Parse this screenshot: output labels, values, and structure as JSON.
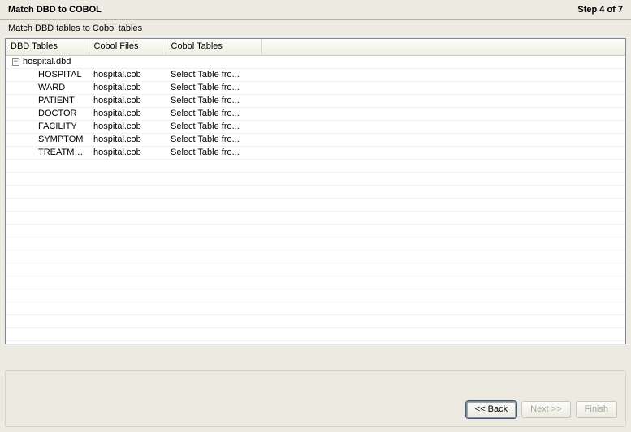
{
  "title": "Match DBD to COBOL",
  "step_label": "Step 4 of 7",
  "subtitle": "Match DBD tables to Cobol tables",
  "columns": {
    "dbd": "DBD Tables",
    "file": "Cobol Files",
    "cobol": "Cobol Tables"
  },
  "tree": {
    "parent": "hospital.dbd",
    "expanded": true,
    "children": [
      {
        "dbd": "HOSPITAL",
        "file": "hospital.cob",
        "cobol": "Select Table fro..."
      },
      {
        "dbd": "WARD",
        "file": "hospital.cob",
        "cobol": "Select Table fro..."
      },
      {
        "dbd": "PATIENT",
        "file": "hospital.cob",
        "cobol": "Select Table fro..."
      },
      {
        "dbd": "DOCTOR",
        "file": "hospital.cob",
        "cobol": "Select Table fro..."
      },
      {
        "dbd": "FACILITY",
        "file": "hospital.cob",
        "cobol": "Select Table fro..."
      },
      {
        "dbd": "SYMPTOM",
        "file": "hospital.cob",
        "cobol": "Select Table fro..."
      },
      {
        "dbd": "TREATMNT",
        "file": "hospital.cob",
        "cobol": "Select Table fro..."
      }
    ]
  },
  "buttons": {
    "back": "<< Back",
    "next": "Next >>",
    "finish": "Finish"
  },
  "empty_row_count": 14
}
